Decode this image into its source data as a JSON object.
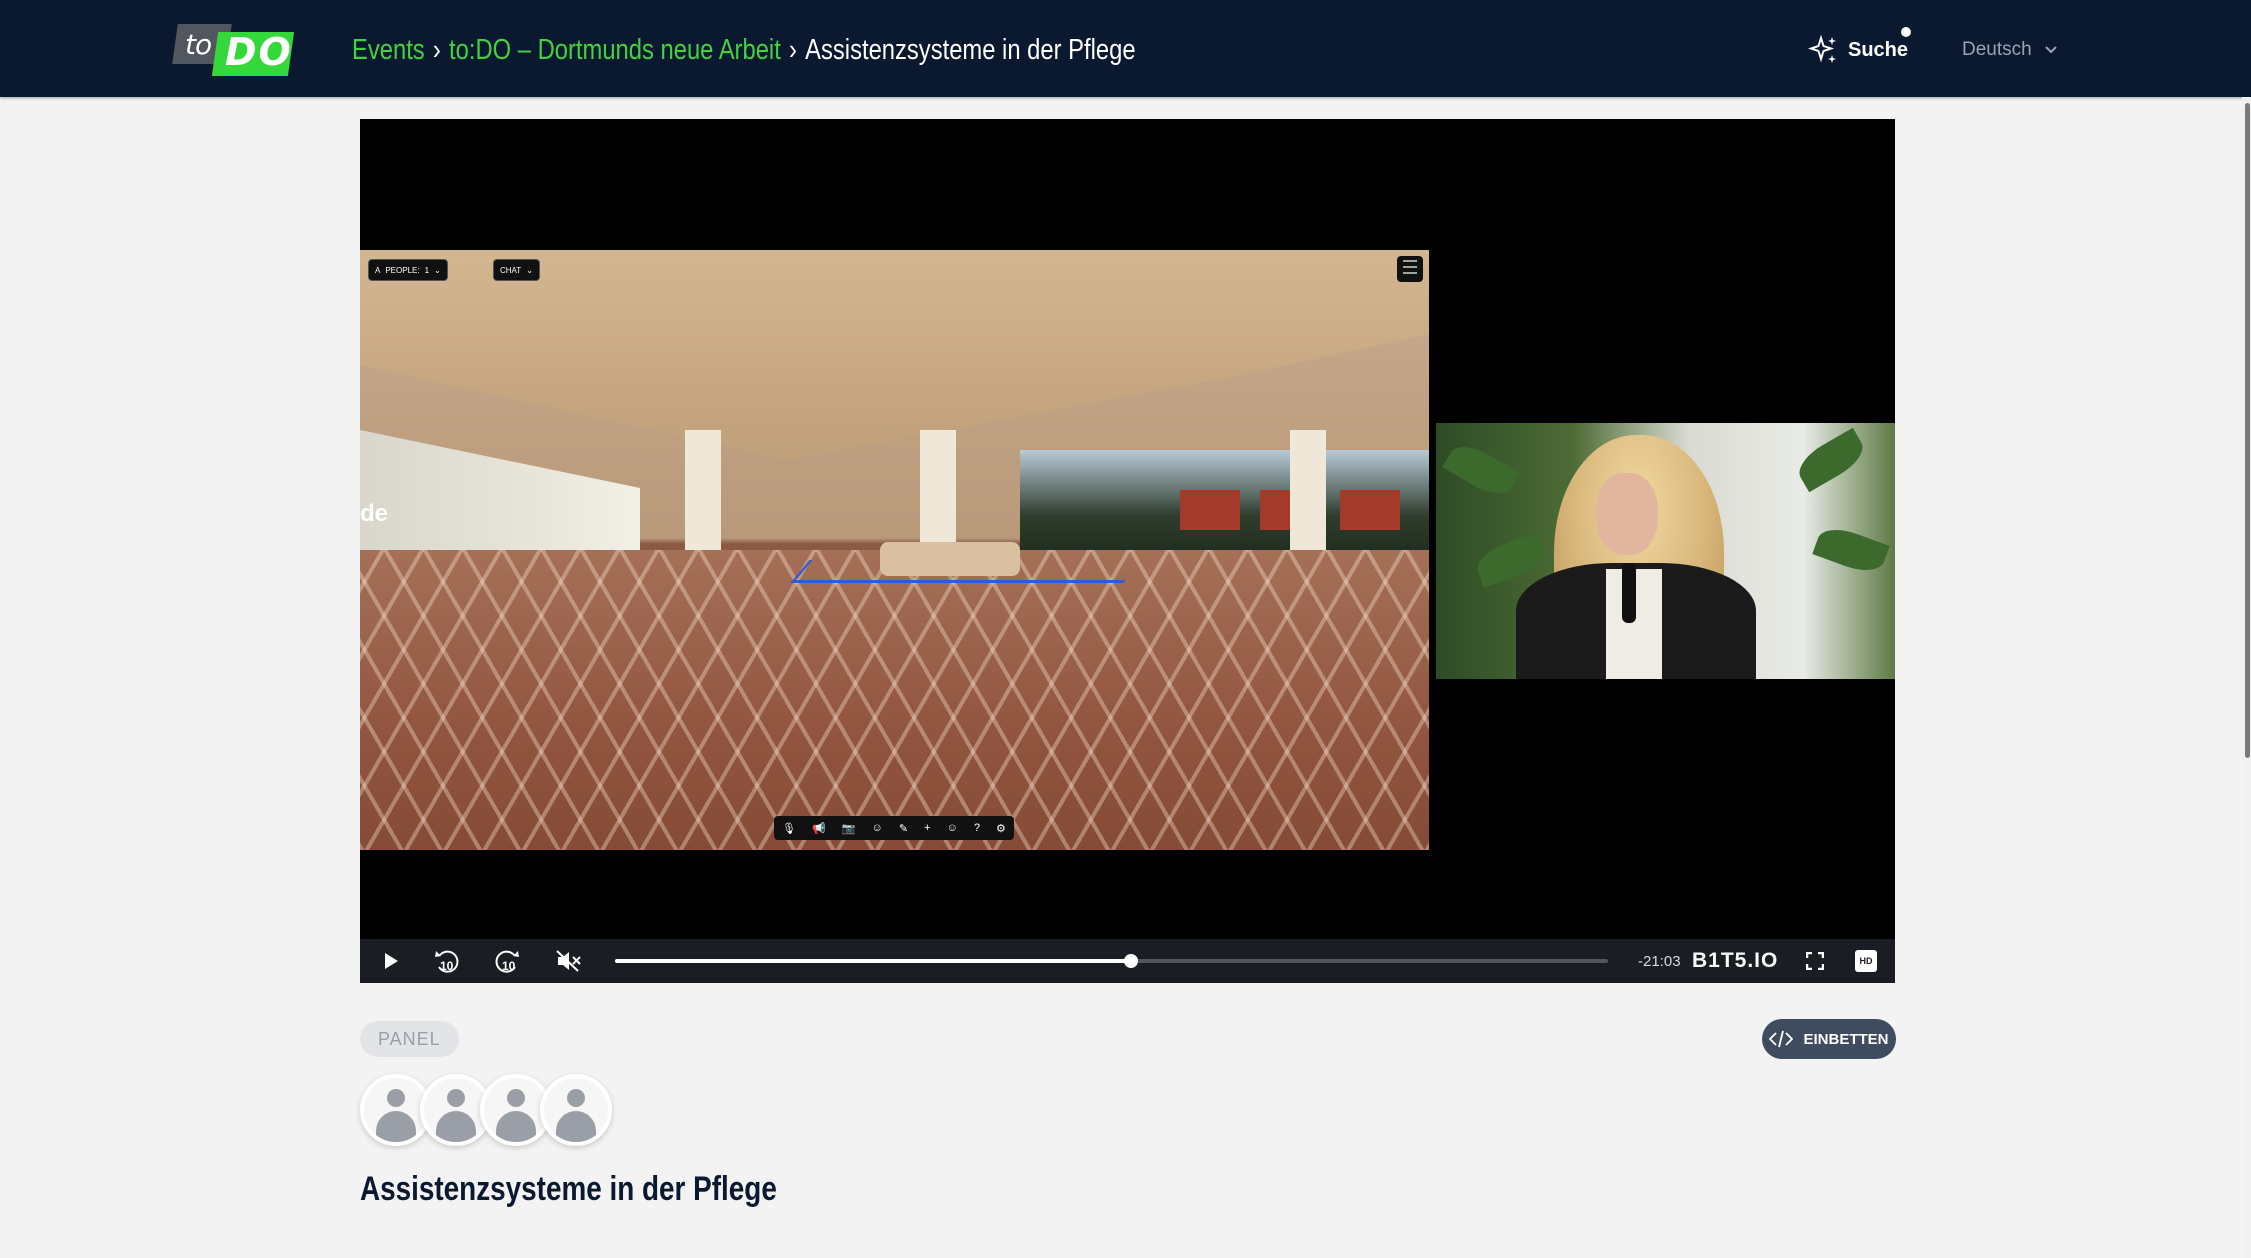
{
  "header": {
    "logo_small": "to",
    "logo_big": "DO",
    "breadcrumb": [
      {
        "label": "Events",
        "link": true
      },
      {
        "label": "to:DO – Dortmunds neue Arbeit",
        "link": true
      },
      {
        "label": "Assistenzsysteme in der Pflege",
        "link": false
      }
    ],
    "separator": "›",
    "search_label": "Suche",
    "language": "Deutsch"
  },
  "player": {
    "hud": {
      "people_label": "PEOPLE:",
      "people_count": "1",
      "chat_label": "CHAT"
    },
    "scene_text": "de",
    "progress": 0.52,
    "remaining_time": "-21:03",
    "brand": "B1T5.IO",
    "hd_label": "HD",
    "rewind_label": "10",
    "forward_label": "10"
  },
  "tag_label": "PANEL",
  "embed_label": "EINBETTEN",
  "avatars": [
    "speaker-1",
    "speaker-2",
    "speaker-3",
    "speaker-4"
  ],
  "event_title": "Assistenzsysteme in der Pflege",
  "colors": {
    "header_bg": "#0b1930",
    "accent_green": "#41d23f",
    "embed_bg": "#3f4b5e",
    "page_bg": "#f3f3f4"
  }
}
